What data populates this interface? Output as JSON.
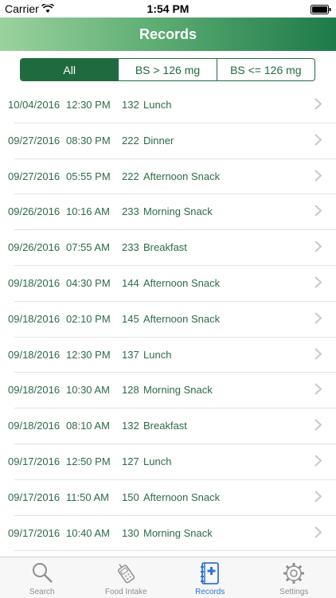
{
  "status_bar": {
    "carrier": "Carrier",
    "time": "1:54 PM"
  },
  "nav": {
    "title": "Records"
  },
  "filters": {
    "options": [
      {
        "label": "All",
        "active": true
      },
      {
        "label": "BS > 126 mg",
        "active": false
      },
      {
        "label": "BS <= 126 mg",
        "active": false
      }
    ]
  },
  "records": [
    {
      "date": "10/04/2016",
      "time": "12:30 PM",
      "bs": "132",
      "meal": "Lunch"
    },
    {
      "date": "09/27/2016",
      "time": "08:30 PM",
      "bs": "222",
      "meal": "Dinner"
    },
    {
      "date": "09/27/2016",
      "time": "05:55 PM",
      "bs": "222",
      "meal": "Afternoon Snack"
    },
    {
      "date": "09/26/2016",
      "time": "10:16 AM",
      "bs": "233",
      "meal": "Morning Snack"
    },
    {
      "date": "09/26/2016",
      "time": "07:55 AM",
      "bs": "233",
      "meal": "Breakfast"
    },
    {
      "date": "09/18/2016",
      "time": "04:30 PM",
      "bs": "144",
      "meal": "Afternoon Snack"
    },
    {
      "date": "09/18/2016",
      "time": "02:10 PM",
      "bs": "145",
      "meal": "Afternoon Snack"
    },
    {
      "date": "09/18/2016",
      "time": "12:30 PM",
      "bs": "137",
      "meal": "Lunch"
    },
    {
      "date": "09/18/2016",
      "time": "10:30 AM",
      "bs": "128",
      "meal": "Morning Snack"
    },
    {
      "date": "09/18/2016",
      "time": "08:10 AM",
      "bs": "132",
      "meal": "Breakfast"
    },
    {
      "date": "09/17/2016",
      "time": "12:50 PM",
      "bs": "127",
      "meal": "Lunch"
    },
    {
      "date": "09/17/2016",
      "time": "11:50 AM",
      "bs": "150",
      "meal": "Afternoon Snack"
    },
    {
      "date": "09/17/2016",
      "time": "10:40 AM",
      "bs": "130",
      "meal": "Morning Snack"
    }
  ],
  "tabs": [
    {
      "label": "Search",
      "icon": "search-icon",
      "active": false
    },
    {
      "label": "Food Intake",
      "icon": "glucose-meter-icon",
      "active": false
    },
    {
      "label": "Records",
      "icon": "records-book-icon",
      "active": true
    },
    {
      "label": "Settings",
      "icon": "gear-icon",
      "active": false
    }
  ],
  "colors": {
    "accent": "#1f6a3f",
    "text": "#2d6a47",
    "active_tab": "#2f74d0"
  }
}
